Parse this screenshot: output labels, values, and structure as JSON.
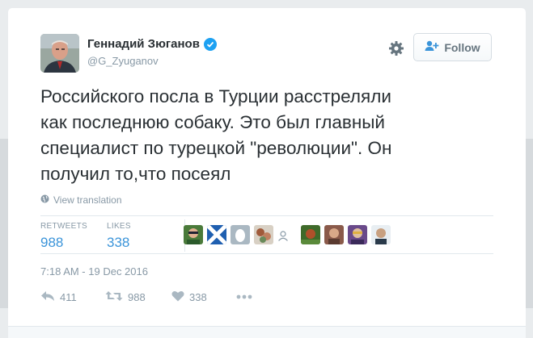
{
  "author": {
    "display_name": "Геннадий Зюганов",
    "handle": "@G_Zyuganov"
  },
  "follow_button": {
    "label": "Follow"
  },
  "tweet": {
    "text": "Российского посла в Турции расстреляли\nкак последнюю собаку. Это был главный\nспециалист по турецкой \"революции\". Он\nполучил то,что посеял",
    "translate_label": "View translation",
    "timestamp": "7:18 AM - 19 Dec 2016"
  },
  "stats": {
    "retweets_label": "RETWEETS",
    "retweets_value": "988",
    "likes_label": "LIKES",
    "likes_value": "338"
  },
  "actions": {
    "reply_count": "411",
    "retweet_count": "988",
    "like_count": "338"
  },
  "colors": {
    "link_blue": "#3b94d9",
    "verified_blue": "#1da1f2",
    "muted_gray": "#8899a6",
    "text_dark": "#292f33"
  },
  "icons": [
    "gear-icon",
    "follow-person-icon",
    "verified-icon",
    "globe-icon",
    "reply-icon",
    "retweet-icon",
    "heart-icon",
    "more-icon"
  ]
}
